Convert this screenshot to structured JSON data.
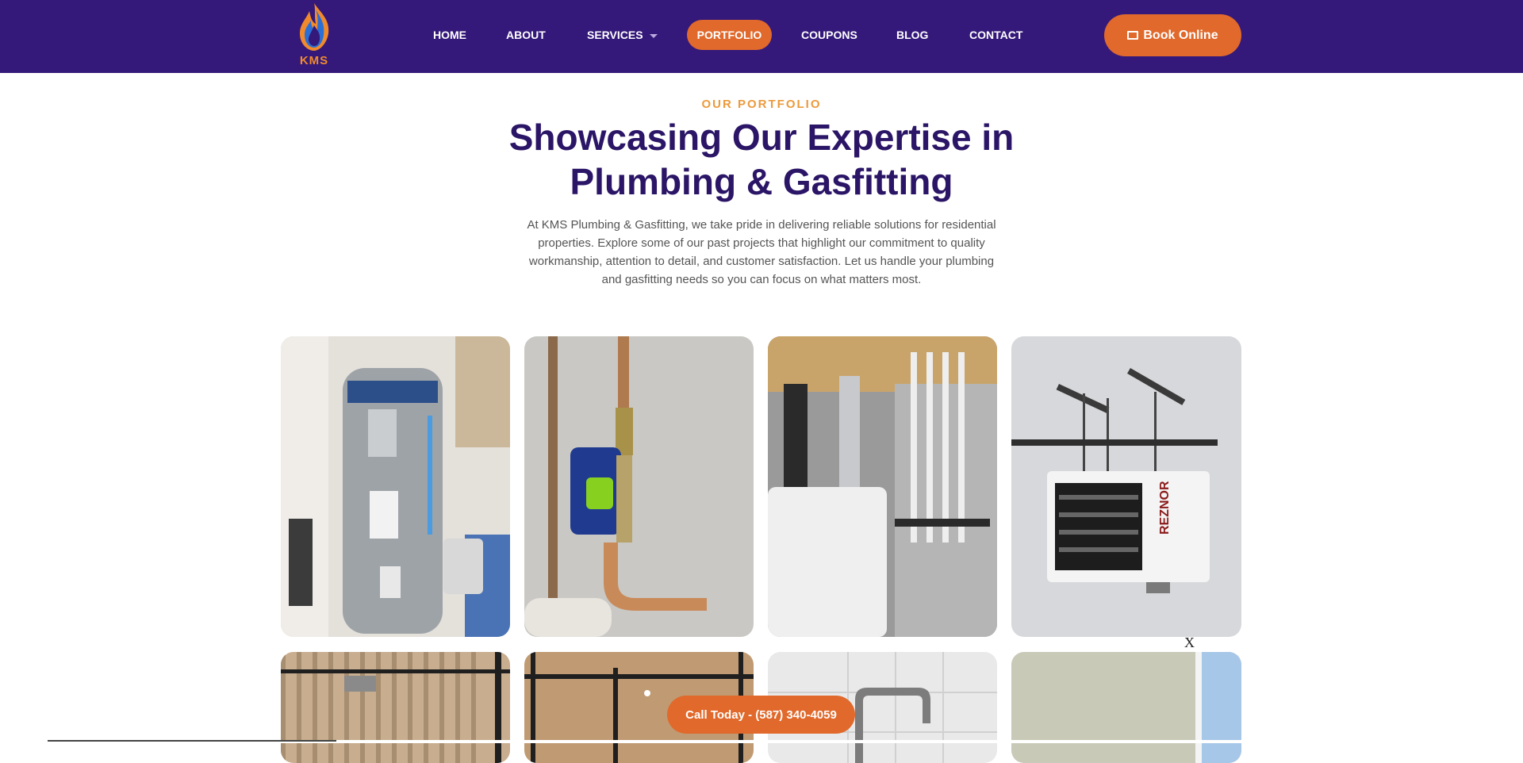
{
  "header": {
    "logo_text": "KMS",
    "nav": [
      "HOME",
      "ABOUT",
      "SERVICES",
      "PORTFOLIO",
      "COUPONS",
      "BLOG",
      "CONTACT"
    ],
    "active_nav": "PORTFOLIO",
    "book_button": "Book Online"
  },
  "hero": {
    "eyebrow": "OUR PORTFOLIO",
    "title_line1": "Showcasing Our Expertise in",
    "title_line2": "Plumbing & Gasfitting",
    "description": "At KMS Plumbing & Gasfitting, we take pride in delivering reliable solutions for residential properties. Explore some of our past projects that highlight our commitment to quality workmanship, attention to detail, and customer satisfaction. Let us handle your plumbing and gasfitting needs so you can focus on what matters most."
  },
  "gallery": {
    "tiles": [
      {
        "name": "water-heater-photo"
      },
      {
        "name": "flo-valve-photo"
      },
      {
        "name": "boiler-piping-photo"
      },
      {
        "name": "reznor-heater-photo",
        "brand": "REZNOR"
      },
      {
        "name": "shower-tile-photo"
      },
      {
        "name": "shower-glass-photo"
      },
      {
        "name": "faucet-photo"
      },
      {
        "name": "window-photo"
      }
    ]
  },
  "cta": {
    "call_label": "Call Today - (587) 340-4059",
    "close_label": "X"
  },
  "colors": {
    "header_bg": "#34197a",
    "accent": "#e0692b",
    "title": "#2b1566",
    "eyebrow": "#eb9b3c"
  }
}
